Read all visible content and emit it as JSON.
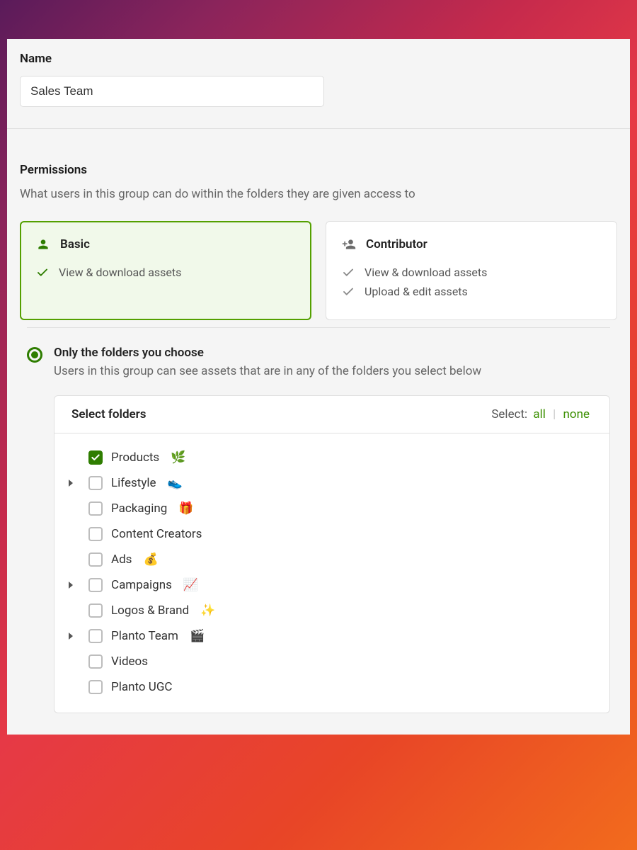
{
  "name_section": {
    "label": "Name",
    "value": "Sales Team"
  },
  "permissions": {
    "heading": "Permissions",
    "description": "What users in this group can do within the folders they are given access to",
    "options": {
      "basic": {
        "title": "Basic",
        "features": [
          "View & download assets"
        ]
      },
      "contributor": {
        "title": "Contributor",
        "features": [
          "View & download assets",
          "Upload & edit assets"
        ]
      }
    }
  },
  "folder_access": {
    "radio_label": "Only the folders you choose",
    "radio_desc": "Users in this group can see assets that are in any of the folders you select below"
  },
  "folder_picker": {
    "title": "Select folders",
    "select_label": "Select:",
    "select_all": "all",
    "select_none": "none",
    "folders": [
      {
        "name": "Products",
        "emoji": "🌿",
        "checked": true,
        "expandable": false
      },
      {
        "name": "Lifestyle",
        "emoji": "👟",
        "checked": false,
        "expandable": true
      },
      {
        "name": "Packaging",
        "emoji": "🎁",
        "checked": false,
        "expandable": false
      },
      {
        "name": "Content Creators",
        "emoji": "",
        "checked": false,
        "expandable": false
      },
      {
        "name": "Ads",
        "emoji": "💰",
        "checked": false,
        "expandable": false
      },
      {
        "name": "Campaigns",
        "emoji": "📈",
        "checked": false,
        "expandable": true
      },
      {
        "name": "Logos & Brand",
        "emoji": "✨",
        "checked": false,
        "expandable": false
      },
      {
        "name": "Planto Team",
        "emoji": "🎬",
        "checked": false,
        "expandable": true
      },
      {
        "name": "Videos",
        "emoji": "",
        "checked": false,
        "expandable": false
      },
      {
        "name": "Planto UGC",
        "emoji": "",
        "checked": false,
        "expandable": false
      }
    ]
  }
}
